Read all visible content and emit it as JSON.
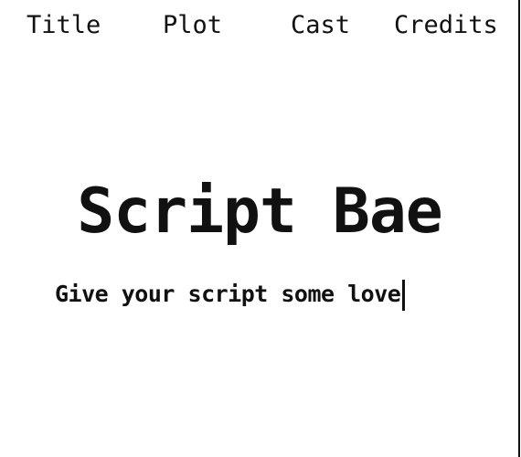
{
  "nav": {
    "items": [
      {
        "label": "Title"
      },
      {
        "label": "Plot"
      },
      {
        "label": "Cast"
      },
      {
        "label": "Credits"
      }
    ]
  },
  "hero": {
    "brand": "Script Bae",
    "tagline": "Give your script some love"
  }
}
